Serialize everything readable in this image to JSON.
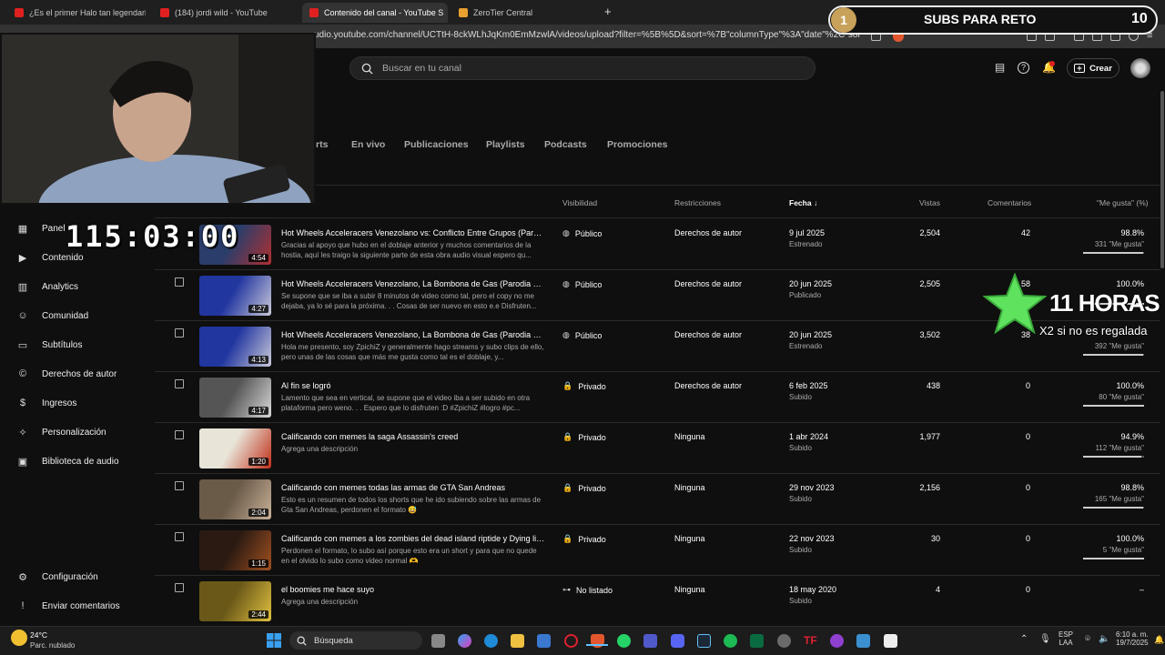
{
  "browser": {
    "tabs": [
      {
        "label": "¿Es el primer Halo tan legendario co",
        "active": false
      },
      {
        "label": "(184) jordi wild - YouTube",
        "active": false
      },
      {
        "label": "Contenido del canal - YouTube S",
        "active": true
      },
      {
        "label": "ZeroTier Central",
        "active": false
      }
    ],
    "new_tab": "+",
    "url": "udio.youtube.com/channel/UCTtH-8ckWLhJqKm0EmMzwlA/videos/upload?filter=%5B%5D&sort=%7B\"columnType\"%3A\"date\"%2C\"sortOrder\"%..."
  },
  "header": {
    "search_placeholder": "Buscar en tu canal",
    "create_label": "Crear"
  },
  "content_tabs": [
    {
      "label": "rts"
    },
    {
      "label": "En vivo"
    },
    {
      "label": "Publicaciones"
    },
    {
      "label": "Playlists"
    },
    {
      "label": "Podcasts"
    },
    {
      "label": "Promociones"
    }
  ],
  "sidebar": {
    "items": [
      {
        "label": "Panel",
        "icon": "dashboard-icon"
      },
      {
        "label": "Contenido",
        "icon": "content-icon"
      },
      {
        "label": "Analytics",
        "icon": "analytics-icon"
      },
      {
        "label": "Comunidad",
        "icon": "community-icon"
      },
      {
        "label": "Subtítulos",
        "icon": "subtitles-icon"
      },
      {
        "label": "Derechos de autor",
        "icon": "copyright-icon"
      },
      {
        "label": "Ingresos",
        "icon": "dollar-icon"
      },
      {
        "label": "Personalización",
        "icon": "magic-wand-icon"
      },
      {
        "label": "Biblioteca de audio",
        "icon": "audio-library-icon"
      }
    ],
    "bottom": [
      {
        "label": "Configuración",
        "icon": "gear-icon"
      },
      {
        "label": "Enviar comentarios",
        "icon": "feedback-icon"
      }
    ]
  },
  "table": {
    "headers": {
      "visibility": "Visibilidad",
      "restrictions": "Restricciones",
      "date": "Fecha",
      "views": "Vistas",
      "comments": "Comentarios",
      "likes": "\"Me gusta\" (%)"
    },
    "rows": [
      {
        "title": "Hot Wheels Acceleracers Venezolano vs: Conflicto Entre Grupos (Parodia)",
        "desc": "Gracias al apoyo que hubo en el doblaje anterior y muchos comentarios de la hostia, aquí les traigo la siguiente parte de esta obra audio visual espero qu...",
        "duration": "4:54",
        "visibility": "Público",
        "restriction": "Derechos de autor",
        "date": "9 jul 2025",
        "date_sub": "Estrenado",
        "views": "2,504",
        "comments": "42",
        "likes": "98.8%",
        "likes_sub": "331 \"Me gusta\"",
        "like_fraction": 0.988,
        "thumb": [
          "#2a3d6b",
          "#b03030"
        ]
      },
      {
        "title": "Hot Wheels Acceleracers Venezolano, La Bombona de Gas (Parodia Par...",
        "desc": "Se supone que se iba a subir 8 minutos de video como tal, pero el copy no me dejaba, ya lo sé para la próxima. . . Cosas de ser nuevo en esto e.e Disfruten...",
        "duration": "4:27",
        "visibility": "Público",
        "restriction": "Derechos de autor",
        "date": "20 jun 2025",
        "date_sub": "Publicado",
        "views": "2,505",
        "comments": "58",
        "likes": "100.0%",
        "likes_sub": "",
        "like_fraction": 1.0,
        "thumb": [
          "#2236a0",
          "#c9c9d9"
        ]
      },
      {
        "title": "Hot Wheels Acceleracers Venezolano, La Bombona de Gas (Parodia Par...",
        "desc": "Hola me presento, soy ZpichiZ y generalmente hago streams y subo clips de ello, pero unas de las cosas que más me gusta como tal es el doblaje, y...",
        "duration": "4:13",
        "visibility": "Público",
        "restriction": "Derechos de autor",
        "date": "20 jun 2025",
        "date_sub": "Estrenado",
        "views": "3,502",
        "comments": "38",
        "likes": "",
        "likes_sub": "392 \"Me gusta\"",
        "like_fraction": 0.99,
        "thumb": [
          "#2236a0",
          "#c9c9d9"
        ]
      },
      {
        "title": "Al fin se logró",
        "desc": "Lamento que sea en vertical, se supone que el video iba a ser subido en otra plataforma pero weno. . . Espero que lo disfruten :D #ZpichiZ #logro #pc...",
        "duration": "4:17",
        "visibility": "Privado",
        "restriction": "Derechos de autor",
        "date": "6 feb 2025",
        "date_sub": "Subido",
        "views": "438",
        "comments": "0",
        "likes": "100.0%",
        "likes_sub": "80 \"Me gusta\"",
        "like_fraction": 1.0,
        "thumb": [
          "#555555",
          "#d8d8d8"
        ]
      },
      {
        "title": "Calificando con memes la saga Assassin's creed",
        "desc": "Agrega una descripción",
        "duration": "1:20",
        "visibility": "Privado",
        "restriction": "Ninguna",
        "date": "1 abr 2024",
        "date_sub": "Subido",
        "views": "1,977",
        "comments": "0",
        "likes": "94.9%",
        "likes_sub": "112 \"Me gusta\"",
        "like_fraction": 0.949,
        "thumb": [
          "#e8e4d8",
          "#c0301a"
        ]
      },
      {
        "title": "Calificando con memes todas las armas de GTA San Andreas",
        "desc": "Esto es un resumen de todos los shorts que he ido subiendo sobre las armas de Gta San Andreas, perdonen el formato 😅",
        "duration": "2:04",
        "visibility": "Privado",
        "restriction": "Ninguna",
        "date": "29 nov 2023",
        "date_sub": "Subido",
        "views": "2,156",
        "comments": "0",
        "likes": "98.8%",
        "likes_sub": "165 \"Me gusta\"",
        "like_fraction": 0.988,
        "thumb": [
          "#6a5a48",
          "#c8b098"
        ]
      },
      {
        "title": "Calificando con memes a los zombies del dead island riptide y Dying lig...",
        "desc": "Perdonen el formato, lo subo así porque esto era un short y para que no quede en el olvido lo subo como video normal 🫶",
        "duration": "1:15",
        "visibility": "Privado",
        "restriction": "Ninguna",
        "date": "22 nov 2023",
        "date_sub": "Subido",
        "views": "30",
        "comments": "0",
        "likes": "100.0%",
        "likes_sub": "5 \"Me gusta\"",
        "like_fraction": 1.0,
        "thumb": [
          "#2a1a12",
          "#a05020"
        ]
      },
      {
        "title": "el boomies me hace suyo",
        "desc": "Agrega una descripción",
        "duration": "2:44",
        "visibility": "No listado",
        "restriction": "Ninguna",
        "date": "18 may 2020",
        "date_sub": "Subido",
        "views": "4",
        "comments": "0",
        "likes": "–",
        "likes_sub": "",
        "like_fraction": 0,
        "thumb": [
          "#6a5818",
          "#e0c040"
        ]
      }
    ]
  },
  "overlays": {
    "timer": "115:03:00",
    "subs_count": "1",
    "subs_label": "SUBS PARA RETO",
    "subs_goal": "10",
    "hours_label": "11 HORAS",
    "hours_sub": "X2 si no es regalada",
    "star_color": "#5fe35f"
  },
  "taskbar": {
    "weather_temp": "24°C",
    "weather_desc": "Parc. nublado",
    "search_label": "Búsqueda",
    "lang": "ESP",
    "lang_sub": "LAA",
    "time": "6:10 a. m.",
    "date": "19/7/2025"
  }
}
